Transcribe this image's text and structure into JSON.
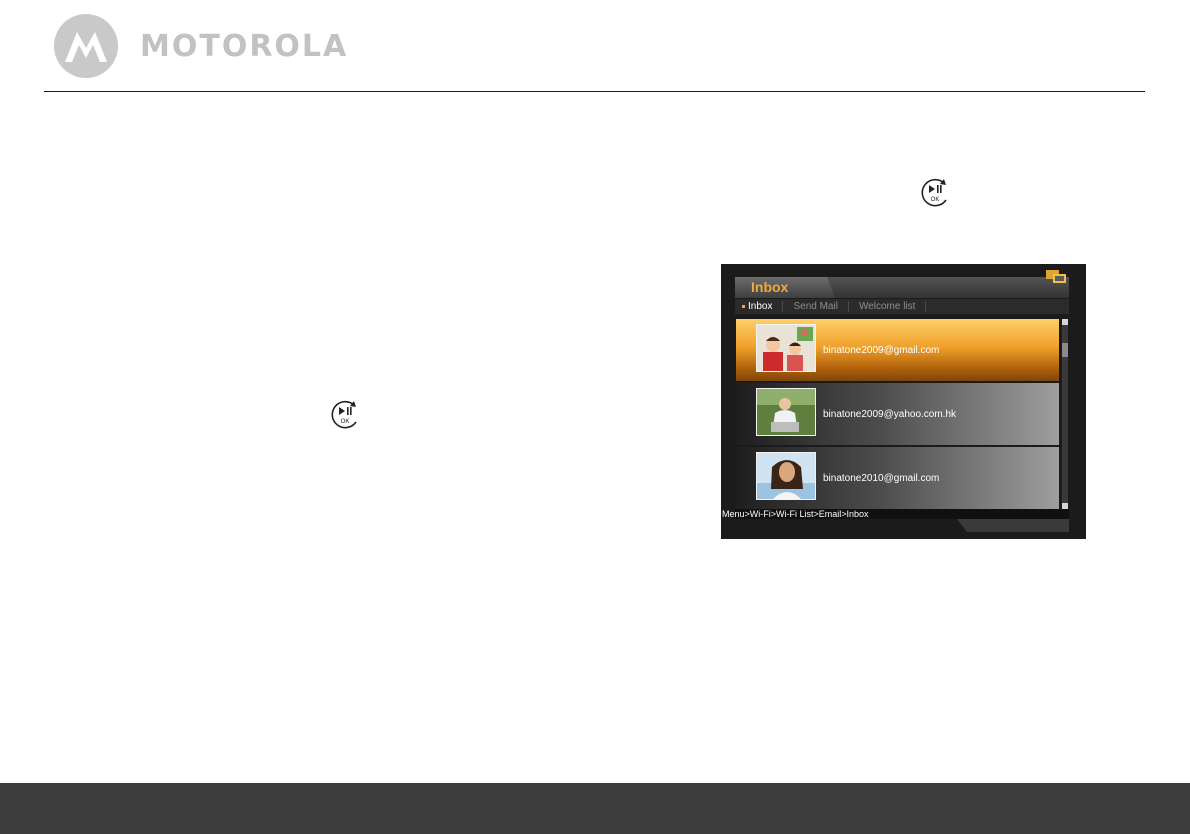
{
  "header": {
    "brand_name": "MOTOROLA",
    "logo_icon": "motorola-batwing-icon"
  },
  "icons": {
    "ok_button_icon": "play-pause-ok-button-icon",
    "ok_label": "OK"
  },
  "screen": {
    "title": "Inbox",
    "tabs": [
      {
        "label": "Inbox",
        "active": true
      },
      {
        "label": "Send Mail",
        "active": false
      },
      {
        "label": "Welcome list",
        "active": false
      }
    ],
    "emails": [
      {
        "address": "binatone2009@gmail.com",
        "selected": true,
        "thumb_icon": "children-photo-icon"
      },
      {
        "address": "binatone2009@yahoo.com.hk",
        "selected": false,
        "thumb_icon": "man-with-laptop-photo-icon"
      },
      {
        "address": "binatone2010@gmail.com",
        "selected": false,
        "thumb_icon": "woman-portrait-photo-icon"
      }
    ],
    "breadcrumb": "Menu>Wi-Fi>Wi-Fi List>Email>Inbox",
    "status_icon": "wifi-connection-icon"
  },
  "colors": {
    "accent": "#f2a93b",
    "footer": "#3d3d3d"
  }
}
